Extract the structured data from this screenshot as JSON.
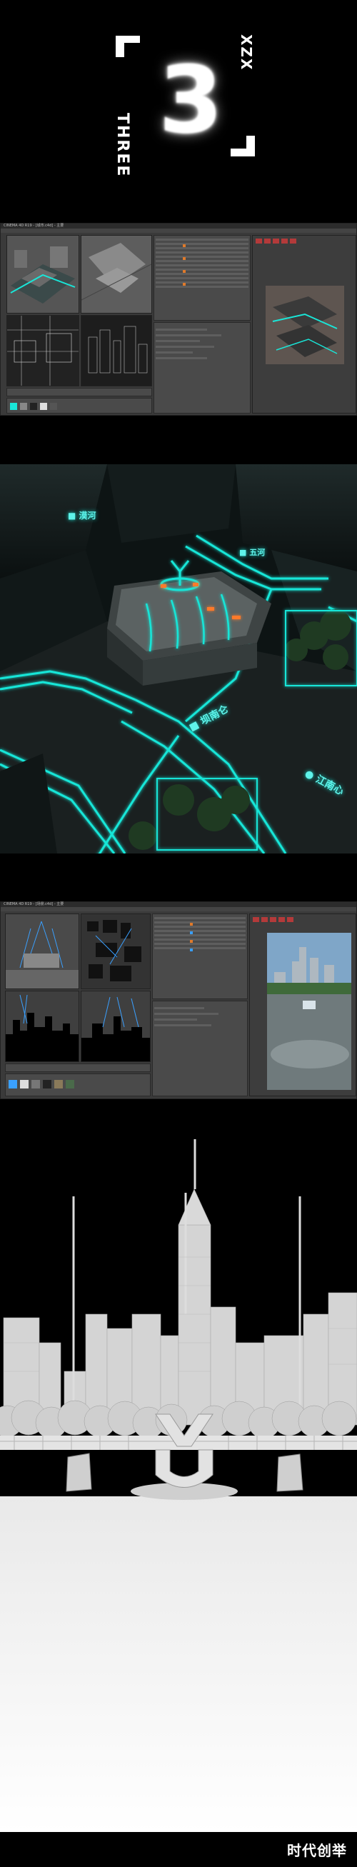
{
  "title_section": {
    "side_text": "THREE",
    "corner_text": "XZX",
    "number": "3"
  },
  "editor1": {
    "window_title": "CINEMA 4D R19 - [城市.c4d] - 主要"
  },
  "render_labels": {
    "label_1": "■ 漠河",
    "label_2": "■ 五河",
    "label_3": "■ 坝南仑",
    "label_4": "● 江南心"
  },
  "editor2": {
    "window_title": "CINEMA 4D R19 - [场景.c4d] - 主要"
  },
  "footer": {
    "watermark": "时代创举"
  },
  "colors": {
    "neon_cyan": "#19e6d8",
    "neon_orange": "#ff7a2a",
    "editor_bg": "#3a3a3a"
  }
}
